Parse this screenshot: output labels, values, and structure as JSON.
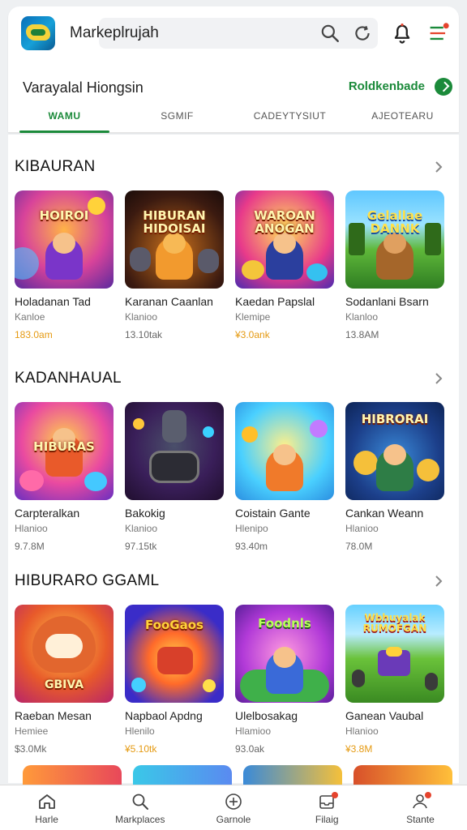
{
  "header": {
    "app_title": "Markeplrujah",
    "icons": [
      "app-logo",
      "search-icon",
      "refresh-icon",
      "bell-icon",
      "filter-icon"
    ]
  },
  "store": {
    "title": "Varayalal Hiongsin",
    "link": "Roldkenbade"
  },
  "tabs": [
    {
      "label": "WAMU",
      "active": true
    },
    {
      "label": "SGMIF",
      "active": false
    },
    {
      "label": "CADEYTYSIUT",
      "active": false
    },
    {
      "label": "AJEOTEARU",
      "active": false
    }
  ],
  "sections": [
    {
      "title": "KIBAURAN",
      "items": [
        {
          "thumb_text": "HOIROI",
          "name": "Holadanan Tad",
          "sub": "Kanloe",
          "price": "183.0am",
          "gold": true
        },
        {
          "thumb_text": "HIBURAN HIDOISAI",
          "name": "Karanan Caanlan",
          "sub": "Klanioo",
          "price": "13.10tak",
          "gold": false
        },
        {
          "thumb_text": "WAROAN ANOGAN",
          "name": "Kaedan Papslal",
          "sub": "Klemipe",
          "price": "¥3.0ank",
          "gold": true
        },
        {
          "thumb_text": "Gelallae DANNK",
          "name": "Sodanlani Bsarn",
          "sub": "Klanloo",
          "price": "13.8AM",
          "gold": false
        }
      ]
    },
    {
      "title": "KADANHAUAL",
      "items": [
        {
          "thumb_text": "HIBURAS",
          "name": "Carpteralkan",
          "sub": "Hlanioo",
          "price": "9.7.8M",
          "gold": false
        },
        {
          "thumb_text": "",
          "name": "Bakokig",
          "sub": "Klanioo",
          "price": "97.15tk",
          "gold": false
        },
        {
          "thumb_text": "",
          "name": "Coistain Gante",
          "sub": "Hlenipo",
          "price": "93.40m",
          "gold": false
        },
        {
          "thumb_text": "HIBRORAI",
          "name": "Cankan Weann",
          "sub": "Hlanioo",
          "price": "78.0M",
          "gold": false
        }
      ]
    },
    {
      "title": "HIBURARO GGAML",
      "items": [
        {
          "thumb_text": "GBIVA",
          "name": "Raeban Mesan",
          "sub": "Hemiee",
          "price": "$3.0Mk",
          "gold": false
        },
        {
          "thumb_text": "FooGaos",
          "name": "Napbaol Apdng",
          "sub": "Hlenilo",
          "price": "¥5.10tk",
          "gold": true
        },
        {
          "thumb_text": "Foodnls",
          "name": "Ulelbosakag",
          "sub": "Hlamioo",
          "price": "93.0ak",
          "gold": false
        },
        {
          "thumb_text": "Wbhuyalak RUMOFGAN",
          "name": "Ganean Vaubal",
          "sub": "Hlanioo",
          "price": "¥3.8M",
          "gold": true
        }
      ]
    }
  ],
  "bottom_nav": [
    {
      "label": "Harle",
      "icon": "home-icon"
    },
    {
      "label": "Markplaces",
      "icon": "search-icon"
    },
    {
      "label": "Garnole",
      "icon": "plus-circle-icon"
    },
    {
      "label": "Filaig",
      "icon": "inbox-icon"
    },
    {
      "label": "Stante",
      "icon": "profile-icon"
    }
  ],
  "colors": {
    "accent": "#1b8a3a",
    "price_gold": "#e59a12",
    "badge": "#e5432d"
  }
}
